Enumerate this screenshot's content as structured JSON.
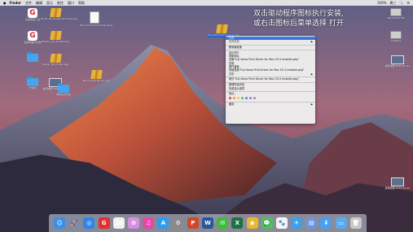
{
  "menubar": {
    "apple": "",
    "items": [
      "Finder",
      "文件",
      "编辑",
      "显示",
      "前往",
      "窗口",
      "帮助"
    ],
    "right_items": [
      "100%",
      "周三",
      "🔍",
      "☰"
    ]
  },
  "hint": {
    "line1": "双击驱动程序图标执行安装,",
    "line2": "或右击图标后菜单选择 打开"
  },
  "desktop_icons": [
    {
      "label": "百度网盘下载",
      "kind": "redapp"
    },
    {
      "label": "Ricoh_PS_Printer_Scanner.pkg",
      "kind": "pkg"
    },
    {
      "label": "Fuji Xerox Print Driver.dmg",
      "kind": "doc"
    },
    {
      "label": "百度网盘同步盘",
      "kind": "redapp"
    },
    {
      "label": "Brother_PS_Printer.pkg",
      "kind": "pkg"
    },
    {
      "label": "",
      "kind": "folder"
    },
    {
      "label": "Canon_PS_Printer.pkg",
      "kind": "pkg"
    },
    {
      "label": "文件夹",
      "kind": "folder"
    },
    {
      "label": "Xerox Print Driver.pkg",
      "kind": "pkg"
    },
    {
      "label": "屏幕快照 2019-10-24",
      "kind": "shot"
    },
    {
      "label": "未命名文件夹",
      "kind": "folder"
    },
    {
      "label": "Fuji Xerox Print Driver.pkg",
      "kind": "pkg"
    },
    {
      "label": "Macintosh HD",
      "kind": "disk"
    },
    {
      "label": "Untitled",
      "kind": "disk"
    },
    {
      "label": "屏幕快照 2019-10-21",
      "kind": "shot"
    },
    {
      "label": "屏幕快照 2019-10-25",
      "kind": "shot"
    }
  ],
  "context_menu": {
    "items": [
      {
        "label": "打开",
        "highlight": true
      },
      {
        "label": "打开方式",
        "arrow": true
      },
      {
        "sep": true
      },
      {
        "label": "移到废纸篓"
      },
      {
        "sep": true
      },
      {
        "label": "显示简介"
      },
      {
        "label": "重新命名"
      },
      {
        "label": "压缩\"Fuji Xerox Print Driver for Mac OS X Installer.pkg\""
      },
      {
        "label": "复制"
      },
      {
        "label": "制作替身"
      },
      {
        "label": "快速查看\"Fuji Xerox Print Driver for Mac OS X Installer.pkg\""
      },
      {
        "label": "共享",
        "arrow": true
      },
      {
        "sep": true
      },
      {
        "label": "拷贝\"Fuji Xerox Print Driver for Mac OS X Installer.pkg\""
      },
      {
        "sep": true
      },
      {
        "label": "整理所选内容"
      },
      {
        "label": "查看显示选项"
      },
      {
        "sep": true
      },
      {
        "label": "标记..."
      },
      {
        "tags": true
      },
      {
        "sep": true
      },
      {
        "label": "服务",
        "arrow": true
      }
    ],
    "tag_colors": [
      "#e64545",
      "#f29b30",
      "#f3d33a",
      "#5ac05a",
      "#3d8ef0",
      "#b068d6",
      "#9a9a9a"
    ]
  },
  "dock": {
    "items": [
      {
        "name": "finder-dock-icon",
        "glyph": "☺",
        "color": "#3b8fe6"
      },
      {
        "name": "launchpad-dock-icon",
        "glyph": "🚀",
        "color": "#7a8ca8"
      },
      {
        "name": "safari-dock-icon",
        "glyph": "◎",
        "color": "#2f86e8"
      },
      {
        "name": "baidu-dock-icon",
        "glyph": "G",
        "color": "#e03030"
      },
      {
        "name": "calendar-dock-icon",
        "glyph": "20",
        "color": "#f0f0f0"
      },
      {
        "name": "photos-dock-icon",
        "glyph": "✿",
        "color": "#d98de0"
      },
      {
        "name": "itunes-dock-icon",
        "glyph": "♫",
        "color": "#e24aa6"
      },
      {
        "name": "appstore-dock-icon",
        "glyph": "A",
        "color": "#2c9ef0"
      },
      {
        "name": "preferences-dock-icon",
        "glyph": "⚙",
        "color": "#8a8a8a"
      },
      {
        "name": "powerpoint-dock-icon",
        "glyph": "P",
        "color": "#d24726"
      },
      {
        "name": "word-dock-icon",
        "glyph": "W",
        "color": "#2b5797"
      },
      {
        "name": "wechat-dock-icon",
        "glyph": "✉",
        "color": "#3dbd3d"
      },
      {
        "name": "excel-dock-icon",
        "glyph": "X",
        "color": "#1e7145"
      },
      {
        "name": "chrome-dock-icon",
        "glyph": "◉",
        "color": "#e8b82f"
      },
      {
        "name": "messages-dock-icon",
        "glyph": "💬",
        "color": "#48c55a"
      },
      {
        "name": "paw-dock-icon",
        "glyph": "🐾",
        "color": "#f5f5f5"
      },
      {
        "name": "bird-dock-icon",
        "glyph": "✈",
        "color": "#3da0e8"
      },
      {
        "name": "preview-dock-icon",
        "glyph": "▤",
        "color": "#6c96d8"
      },
      {
        "name": "downloads-dock-icon",
        "glyph": "⬇",
        "color": "#48a0ee"
      },
      {
        "name": "folder-dock-icon",
        "glyph": "▭",
        "color": "#5aaaf0"
      },
      {
        "name": "trash-dock-icon",
        "glyph": "🗑",
        "color": "#c8c8c8"
      }
    ]
  }
}
